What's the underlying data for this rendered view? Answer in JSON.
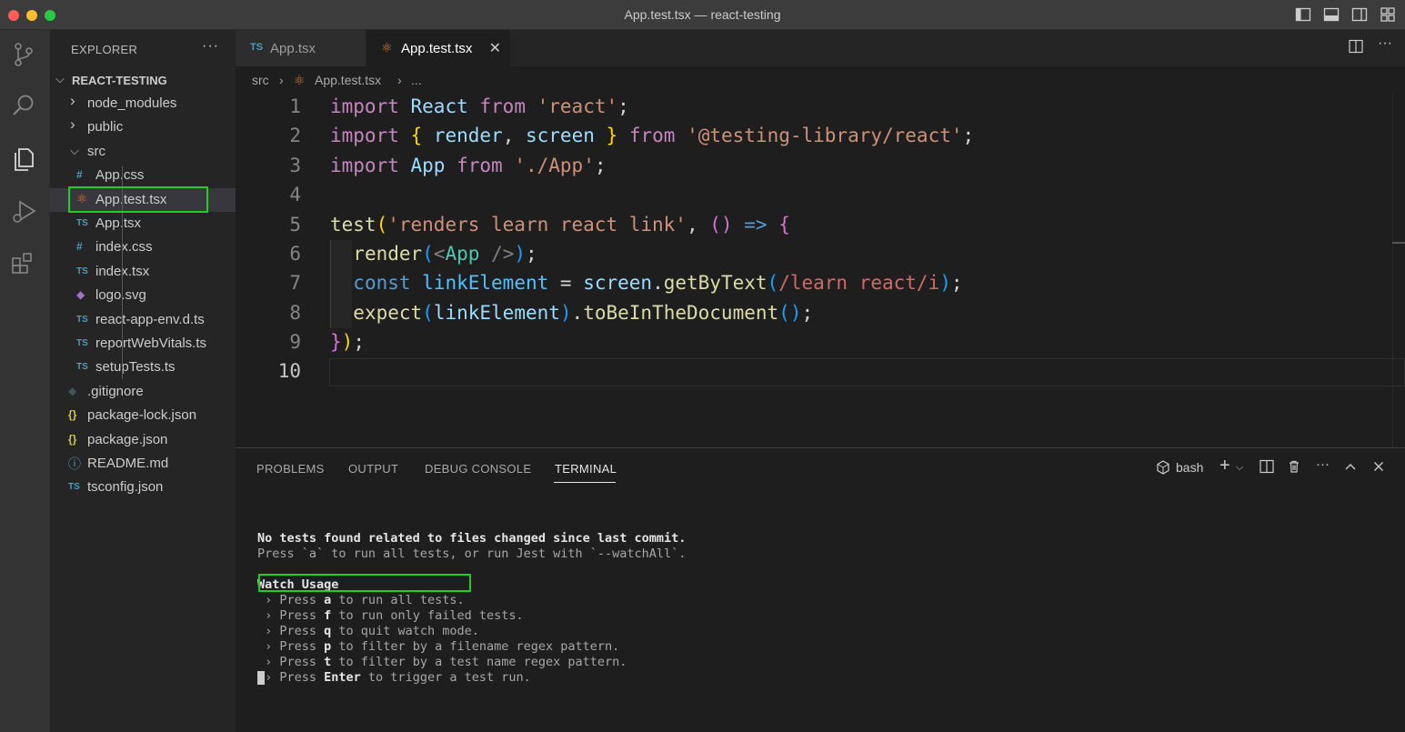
{
  "window": {
    "title": "App.test.tsx — react-testing"
  },
  "activity_bar": {
    "icons": [
      "source-control-icon",
      "search-icon",
      "explorer-icon",
      "run-debug-icon",
      "extensions-icon"
    ]
  },
  "explorer": {
    "title": "EXPLORER",
    "more": "···",
    "root": "REACT-TESTING",
    "items": [
      {
        "label": "node_modules",
        "type": "folder",
        "icon": "",
        "expanded": false
      },
      {
        "label": "public",
        "type": "folder",
        "icon": "",
        "expanded": false
      },
      {
        "label": "src",
        "type": "folder",
        "icon": "",
        "expanded": true
      },
      {
        "label": "App.css",
        "type": "file",
        "icon": "#",
        "color": "#519aba"
      },
      {
        "label": "App.test.tsx",
        "type": "file",
        "icon": "⚛",
        "color": "#e37933",
        "selected": true
      },
      {
        "label": "App.tsx",
        "type": "file",
        "icon": "TS",
        "color": "#519aba"
      },
      {
        "label": "index.css",
        "type": "file",
        "icon": "#",
        "color": "#519aba"
      },
      {
        "label": "index.tsx",
        "type": "file",
        "icon": "TS",
        "color": "#519aba"
      },
      {
        "label": "logo.svg",
        "type": "file",
        "icon": "◆",
        "color": "#a074c4"
      },
      {
        "label": "react-app-env.d.ts",
        "type": "file",
        "icon": "TS",
        "color": "#519aba"
      },
      {
        "label": "reportWebVitals.ts",
        "type": "file",
        "icon": "TS",
        "color": "#519aba"
      },
      {
        "label": "setupTests.ts",
        "type": "file",
        "icon": "TS",
        "color": "#519aba"
      },
      {
        "label": ".gitignore",
        "type": "file",
        "icon": "◆",
        "color": "#41535b"
      },
      {
        "label": "package-lock.json",
        "type": "file",
        "icon": "{}",
        "color": "#cbcb41"
      },
      {
        "label": "package.json",
        "type": "file",
        "icon": "{}",
        "color": "#cbcb41"
      },
      {
        "label": "README.md",
        "type": "file",
        "icon": "ⓘ",
        "color": "#519aba"
      },
      {
        "label": "tsconfig.json",
        "type": "file",
        "icon": "TS",
        "color": "#519aba"
      }
    ]
  },
  "tabs": [
    {
      "label": "App.tsx",
      "icon": "TS",
      "active": false
    },
    {
      "label": "App.test.tsx",
      "icon": "⚛",
      "active": true,
      "close": "✕"
    }
  ],
  "breadcrumb": {
    "parts": [
      "src",
      "›",
      "App.test.tsx",
      "›",
      "..."
    ]
  },
  "editor": {
    "line_numbers": [
      "1",
      "2",
      "3",
      "4",
      "5",
      "6",
      "7",
      "8",
      "9",
      "10"
    ],
    "current_line": "10"
  },
  "panel": {
    "tabs": [
      "PROBLEMS",
      "OUTPUT",
      "DEBUG CONSOLE",
      "TERMINAL"
    ],
    "active_tab": "TERMINAL",
    "shell": "bash",
    "terminal": {
      "line1": "No tests found related to files changed since last commit.",
      "line2": "Press `a` to run all tests, or run Jest with `--watchAll`.",
      "heading": "Watch Usage",
      "options": [
        {
          "prefix": " › Press ",
          "key": "a",
          "text": " to run all tests."
        },
        {
          "prefix": " › Press ",
          "key": "f",
          "text": " to run only failed tests."
        },
        {
          "prefix": " › Press ",
          "key": "q",
          "text": " to quit watch mode."
        },
        {
          "prefix": " › Press ",
          "key": "p",
          "text": " to filter by a filename regex pattern."
        },
        {
          "prefix": " › Press ",
          "key": "t",
          "text": " to filter by a test name regex pattern."
        },
        {
          "prefix": " › Press ",
          "key": "Enter",
          "text": " to trigger a test run."
        }
      ]
    }
  },
  "colors": {
    "highlight_box": "#1fd11f",
    "accent": "#007acc"
  }
}
